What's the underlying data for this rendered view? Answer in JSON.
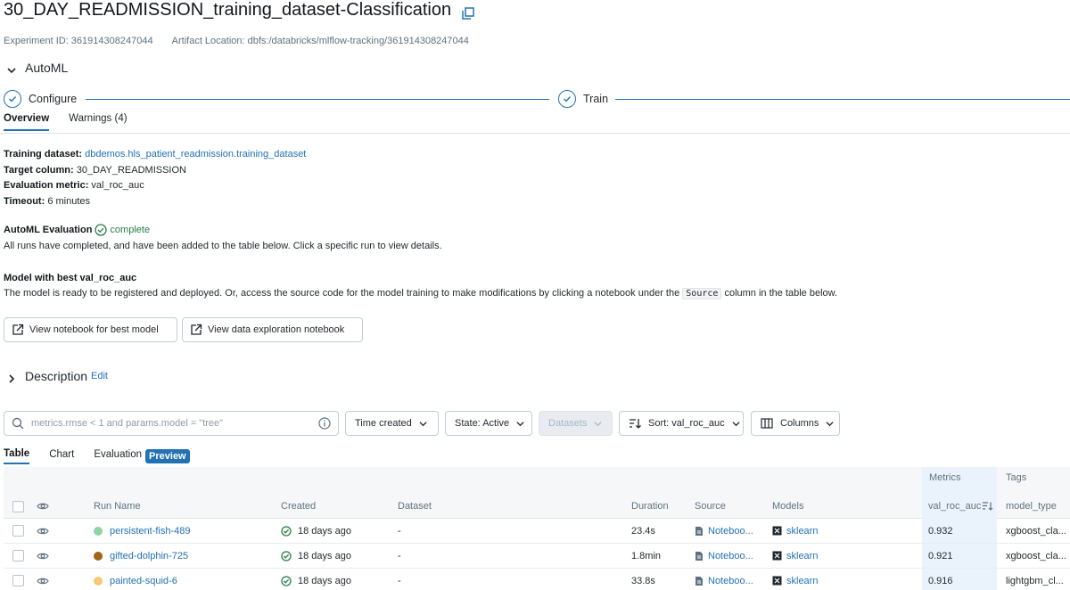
{
  "header": {
    "title": "30_DAY_READMISSION_training_dataset-Classification",
    "experiment_id": "Experiment ID: 361914308247044",
    "artifact_location": "Artifact Location: dbfs:/databricks/mlflow-tracking/361914308247044"
  },
  "automl": {
    "label": "AutoML",
    "steps": [
      "Configure",
      "Train"
    ]
  },
  "tabs": [
    "Overview",
    "Warnings (4)"
  ],
  "info": {
    "training_dataset_label": "Training dataset:",
    "training_dataset_value": "dbdemos.hls_patient_readmission.training_dataset",
    "target_column_label": "Target column:",
    "target_column_value": "30_DAY_READMISSION",
    "evaluation_metric_label": "Evaluation metric:",
    "evaluation_metric_value": "val_roc_auc",
    "timeout_label": "Timeout:",
    "timeout_value": "6 minutes"
  },
  "evaluation": {
    "title": "AutoML Evaluation",
    "status": "complete",
    "text": "All runs have completed, and have been added to the table below. Click a specific run to view details."
  },
  "best_model": {
    "title": "Model with best val_roc_auc",
    "text_before": "The model is ready to be registered and deployed. Or, access the source code for the model training to make modifications by clicking a notebook under the",
    "code": "Source",
    "text_after": "column in the table below."
  },
  "buttons": {
    "view_best": "View notebook for best model",
    "view_exploration": "View data exploration notebook"
  },
  "description": {
    "label": "Description",
    "edit": "Edit"
  },
  "filters": {
    "search_placeholder": "metrics.rmse < 1 and params.model = \"tree\"",
    "time_created": "Time created",
    "state": "State: Active",
    "datasets": "Datasets",
    "sort": "Sort: val_roc_auc",
    "columns": "Columns"
  },
  "view_tabs": [
    "Table",
    "Chart",
    "Evaluation"
  ],
  "preview_badge": "Preview",
  "table": {
    "group_metrics": "Metrics",
    "group_tags": "Tags",
    "headers": {
      "run_name": "Run Name",
      "created": "Created",
      "dataset": "Dataset",
      "duration": "Duration",
      "source": "Source",
      "models": "Models",
      "metric": "val_roc_auc",
      "tag": "model_type"
    },
    "rows": [
      {
        "name": "persistent-fish-489",
        "color": "#8fd3a8",
        "created": "18 days ago",
        "dataset": "-",
        "duration": "23.4s",
        "source": "Noteboo...",
        "model": "sklearn",
        "metric": "0.932",
        "tag": "xgboost_cla..."
      },
      {
        "name": "gifted-dolphin-725",
        "color": "#a0651a",
        "created": "18 days ago",
        "dataset": "-",
        "duration": "1.8min",
        "source": "Noteboo...",
        "model": "sklearn",
        "metric": "0.921",
        "tag": "xgboost_cla..."
      },
      {
        "name": "painted-squid-6",
        "color": "#f5c977",
        "created": "18 days ago",
        "dataset": "-",
        "duration": "33.8s",
        "source": "Noteboo...",
        "model": "sklearn",
        "metric": "0.916",
        "tag": "lightgbm_cl..."
      }
    ]
  },
  "colors": {
    "accent": "#2272b4",
    "success": "#277c43"
  }
}
